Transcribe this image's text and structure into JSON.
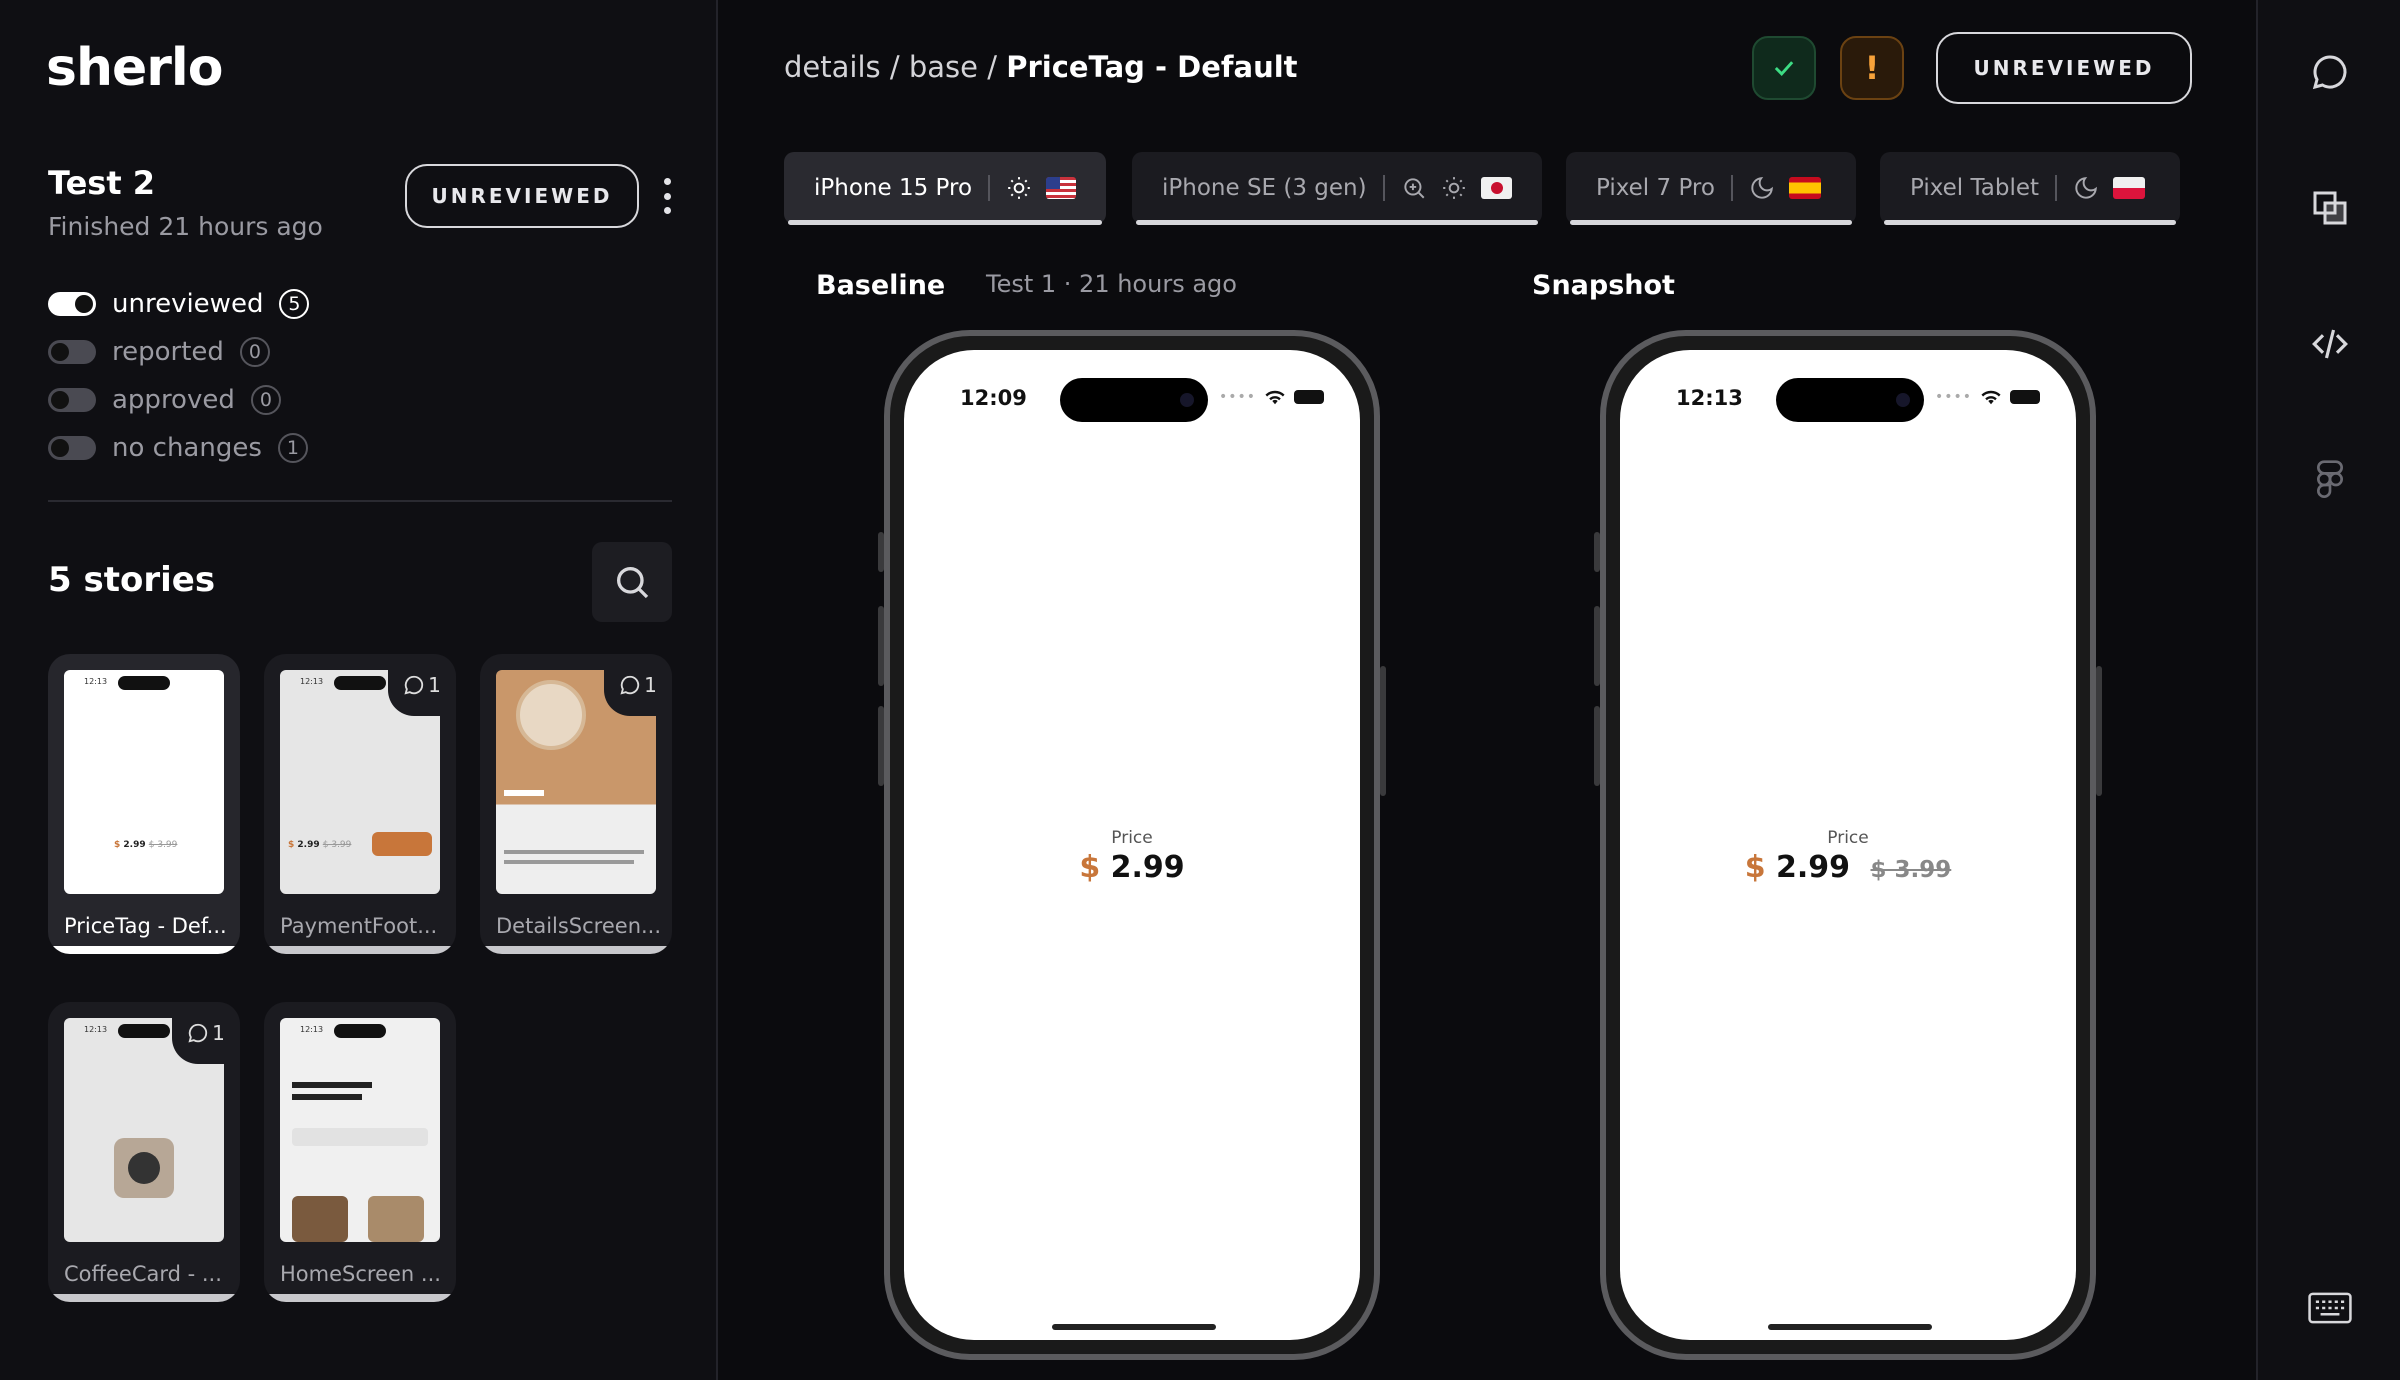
{
  "app": {
    "logo": "sherlo"
  },
  "test": {
    "title": "Test 2",
    "subtitle": "Finished 21 hours ago",
    "status_label": "UNREVIEWED"
  },
  "filters": [
    {
      "label": "unreviewed",
      "count": "5",
      "enabled": true
    },
    {
      "label": "reported",
      "count": "0",
      "enabled": false
    },
    {
      "label": "approved",
      "count": "0",
      "enabled": false
    },
    {
      "label": "no changes",
      "count": "1",
      "enabled": false
    }
  ],
  "stories": {
    "title": "5 stories",
    "items": [
      {
        "label": "PriceTag - Def...",
        "comments": "",
        "selected": true
      },
      {
        "label": "PaymentFoot...",
        "comments": "1",
        "selected": false
      },
      {
        "label": "DetailsScreen...",
        "comments": "1",
        "selected": false
      },
      {
        "label": "CoffeeCard - ...",
        "comments": "1",
        "selected": false
      },
      {
        "label": "HomeScreen ...",
        "comments": "",
        "selected": false
      }
    ]
  },
  "breadcrumb": {
    "part1": "details",
    "sep1": " / ",
    "part2": "base",
    "sep2": " / ",
    "current": "PriceTag - Default"
  },
  "actions": {
    "report_symbol": "!",
    "status_label": "UNREVIEWED"
  },
  "device_tabs": [
    {
      "name": "iPhone 15 Pro",
      "icons": [
        "sun-icon"
      ],
      "flag": "us",
      "active": true
    },
    {
      "name": "iPhone SE (3 gen)",
      "icons": [
        "zoom-icon",
        "sun-icon"
      ],
      "flag": "jp",
      "active": false
    },
    {
      "name": "Pixel 7 Pro",
      "icons": [
        "moon-icon"
      ],
      "flag": "es",
      "active": false
    },
    {
      "name": "Pixel Tablet",
      "icons": [
        "moon-icon"
      ],
      "flag": "pl",
      "active": false
    }
  ],
  "baseline": {
    "title": "Baseline",
    "meta": "Test 1 · 21 hours ago",
    "time": "12:09",
    "price_label": "Price",
    "currency": "$",
    "price": "2.99",
    "old_price": ""
  },
  "snapshot": {
    "title": "Snapshot",
    "time": "12:13",
    "price_label": "Price",
    "currency": "$",
    "price": "2.99",
    "old_price": "$ 3.99"
  },
  "colors": {
    "accent_price": "#c8763a",
    "approve": "#3ddc84",
    "report": "#f7a23a"
  }
}
